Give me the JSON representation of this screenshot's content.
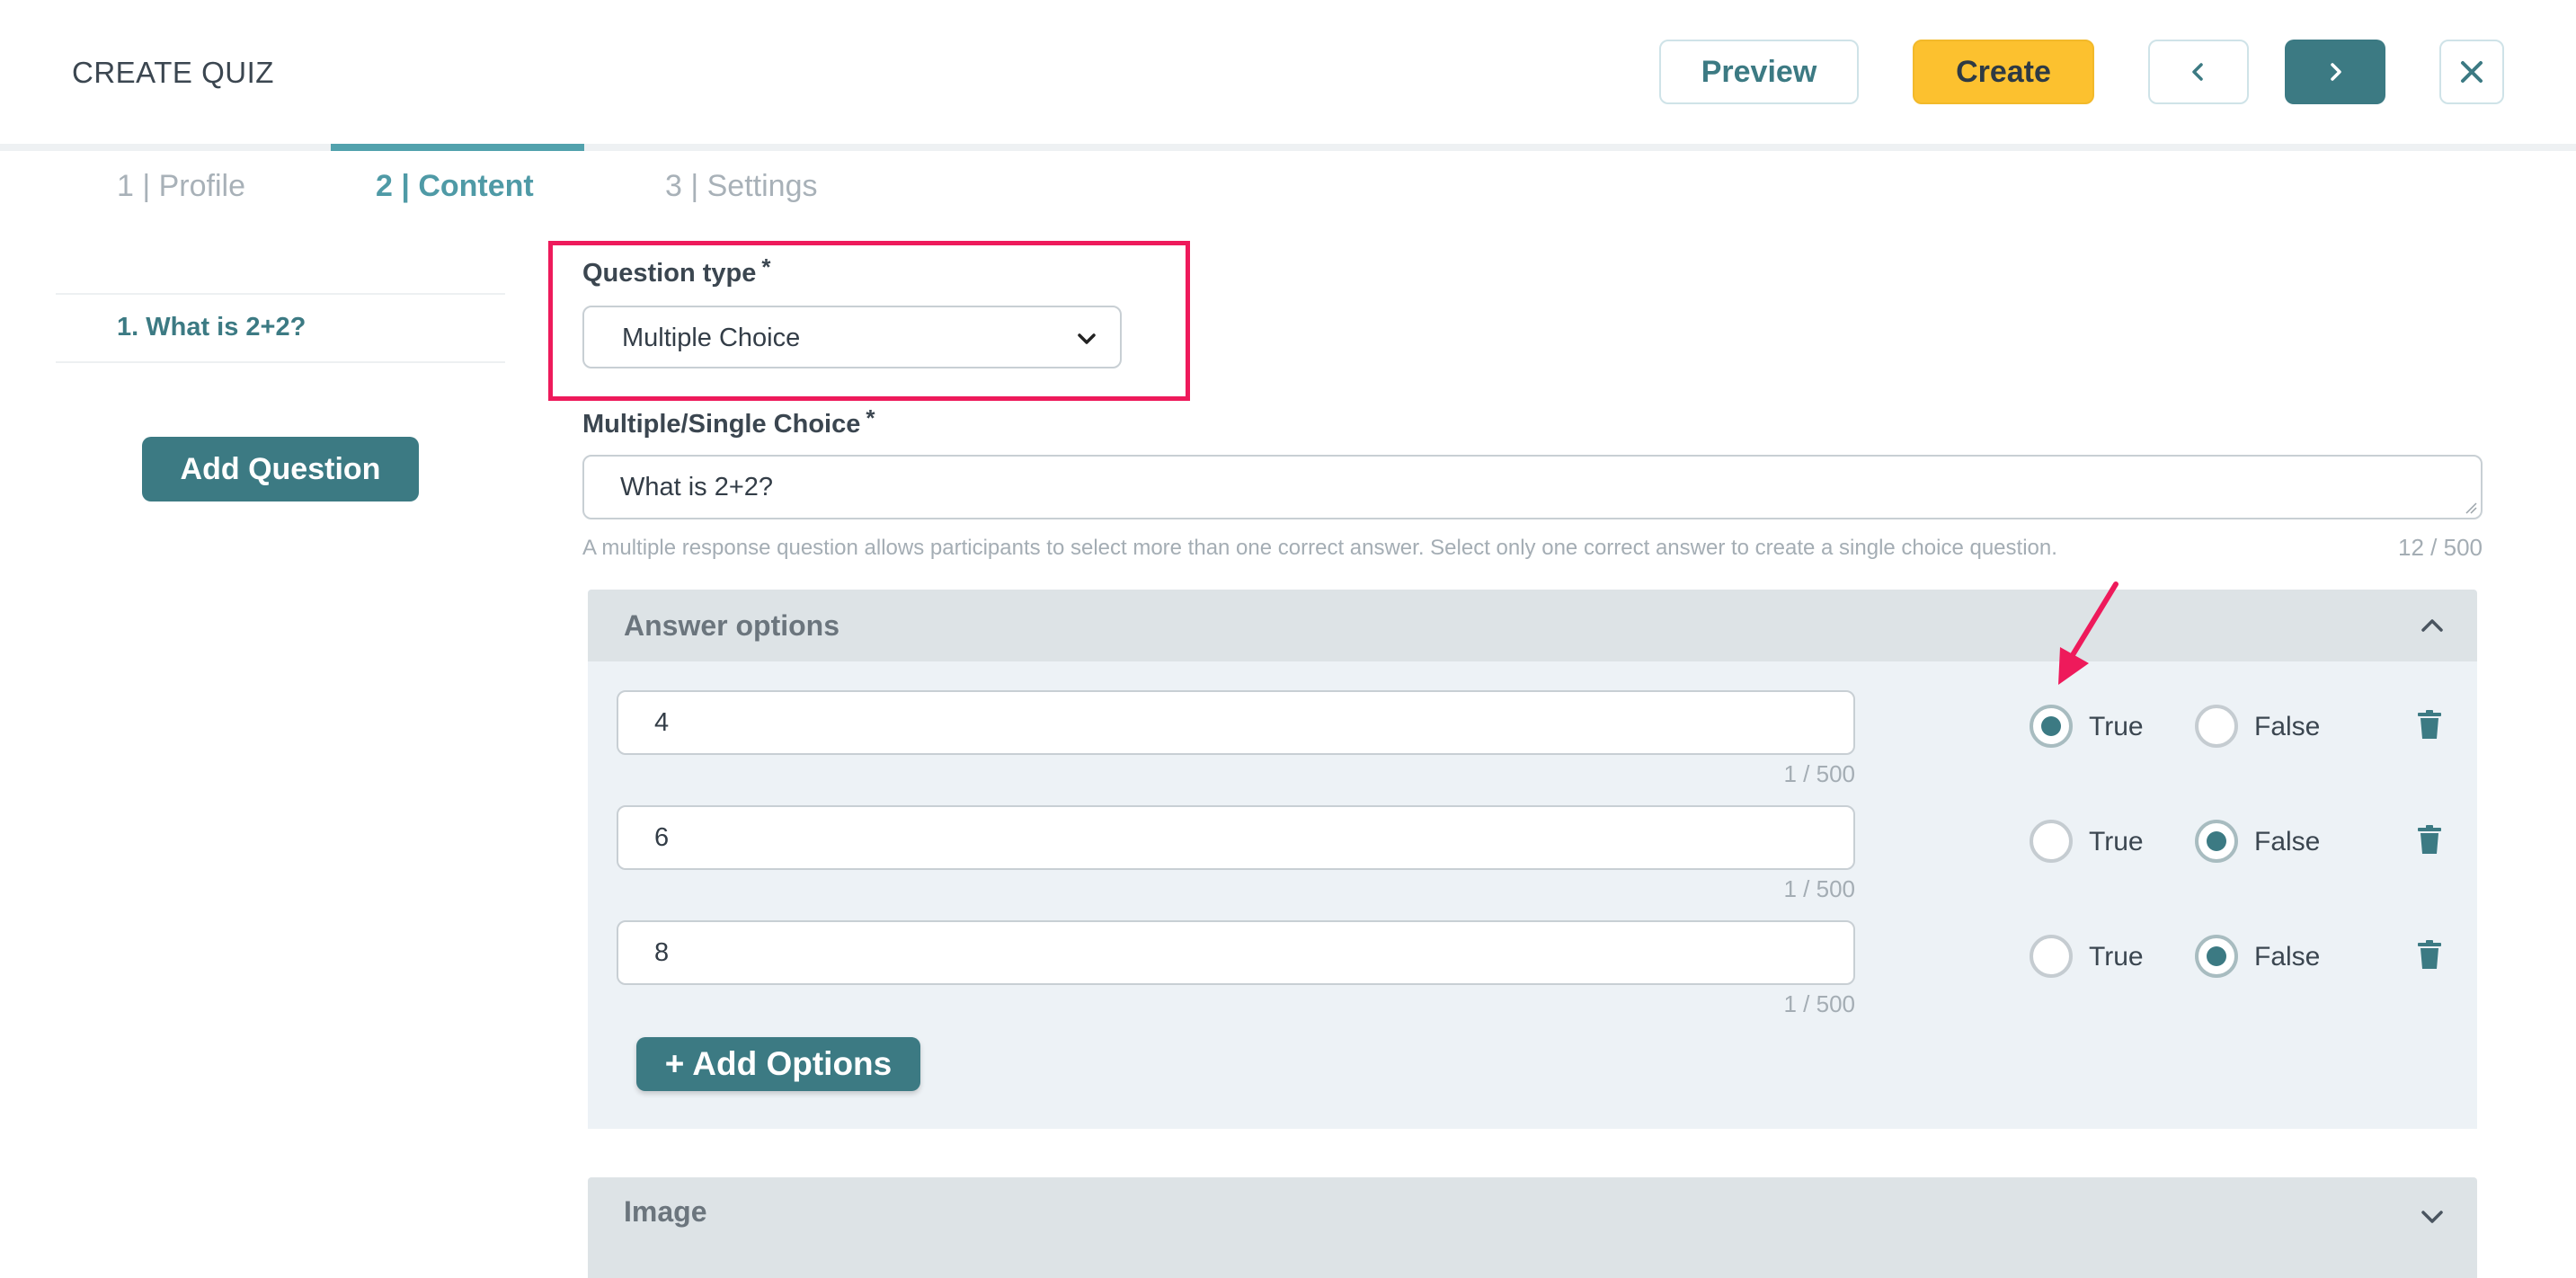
{
  "header": {
    "title": "CREATE QUIZ",
    "preview_label": "Preview",
    "create_label": "Create"
  },
  "tabs": [
    {
      "label": "1 | Profile"
    },
    {
      "label": "2 | Content"
    },
    {
      "label": "3 | Settings"
    }
  ],
  "sidebar": {
    "questions": [
      {
        "label": "1. What is 2+2?"
      }
    ],
    "add_question_label": "Add Question"
  },
  "question_type": {
    "label": "Question type",
    "required_mark": "*",
    "value": "Multiple Choice"
  },
  "question": {
    "label": "Multiple/Single Choice",
    "required_mark": "*",
    "value": "What is 2+2?",
    "help_text": "A multiple response question allows participants to select more than one correct answer. Select only one correct answer to create a single choice question.",
    "counter": "12 / 500"
  },
  "answer_options": {
    "title": "Answer options",
    "true_label": "True",
    "false_label": "False",
    "items": [
      {
        "value": "4",
        "counter": "1 / 500",
        "correct": true
      },
      {
        "value": "6",
        "counter": "1 / 500",
        "correct": false
      },
      {
        "value": "8",
        "counter": "1 / 500",
        "correct": false
      }
    ],
    "add_options_label": "+ Add Options"
  },
  "image_section": {
    "title": "Image"
  },
  "colors": {
    "accent": "#3c7a83",
    "create": "#fcc12f",
    "highlight": "#ee1a5b"
  }
}
